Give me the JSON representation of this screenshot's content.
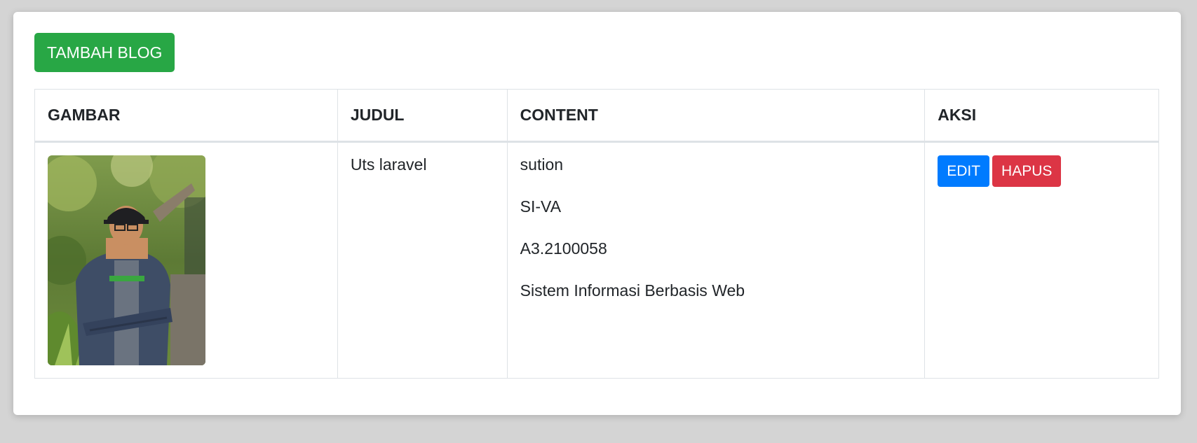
{
  "toolbar": {
    "add_label": "TAMBAH BLOG",
    "add_color": "#28a745"
  },
  "table": {
    "headers": [
      "GAMBAR",
      "JUDUL",
      "CONTENT",
      "AKSI"
    ],
    "rows": [
      {
        "image_alt": "photo",
        "title": "Uts laravel",
        "content": [
          "sution",
          "SI-VA",
          "A3.2100058",
          "Sistem Informasi Berbasis Web"
        ],
        "edit_label": "EDIT",
        "delete_label": "HAPUS"
      }
    ]
  },
  "colors": {
    "edit": "#007bff",
    "delete": "#dc3545",
    "background": "#d4d4d4"
  }
}
